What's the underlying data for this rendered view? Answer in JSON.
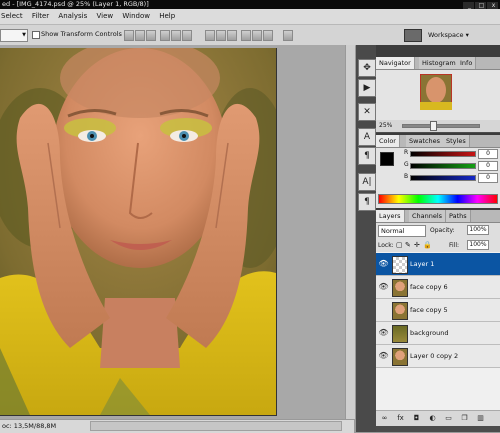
{
  "title_bar": {
    "title": "ed - [IMG_4174.psd @ 25% (Layer 1, RGB/8)]",
    "buttons": [
      "_",
      "□",
      "x"
    ]
  },
  "menubar": {
    "items": [
      "Select",
      "Filter",
      "Analysis",
      "View",
      "Window",
      "Help"
    ]
  },
  "options": {
    "show_transform_controls": "Show Transform Controls",
    "workspace": "Workspace ▾"
  },
  "navigator": {
    "tabs": [
      "Navigator",
      "Histogram",
      "Info"
    ],
    "zoom": "25%"
  },
  "color": {
    "tabs": [
      "Color",
      "Swatches",
      "Styles"
    ],
    "channels": [
      {
        "label": "R",
        "value": "0",
        "color": "#c81414"
      },
      {
        "label": "G",
        "value": "0",
        "color": "#14a014"
      },
      {
        "label": "B",
        "value": "0",
        "color": "#1428c8"
      }
    ],
    "foreground": "#000000",
    "background": "#ffffff"
  },
  "layers": {
    "tabs": [
      "Layers",
      "Channels",
      "Paths"
    ],
    "blend_mode": "Normal",
    "opacity_label": "Opacity:",
    "opacity": "100%",
    "lock_label": "Lock:",
    "fill_label": "Fill:",
    "fill": "100%",
    "items": [
      {
        "name": "Layer 1",
        "selected": true,
        "visible": true,
        "thumb": "transparent"
      },
      {
        "name": "face copy 6",
        "selected": false,
        "visible": true,
        "thumb": "face"
      },
      {
        "name": "face copy 5",
        "selected": false,
        "visible": false,
        "thumb": "face"
      },
      {
        "name": "background",
        "selected": false,
        "visible": true,
        "thumb": "green"
      },
      {
        "name": "Layer 0 copy 2",
        "selected": false,
        "visible": true,
        "thumb": "face"
      }
    ]
  },
  "status": {
    "doc": "oc: 13,5M/88,8M"
  },
  "tools": [
    "move-tool",
    "brush-tool",
    "zoom-tool",
    "type-tool",
    "paragraph-tool"
  ]
}
